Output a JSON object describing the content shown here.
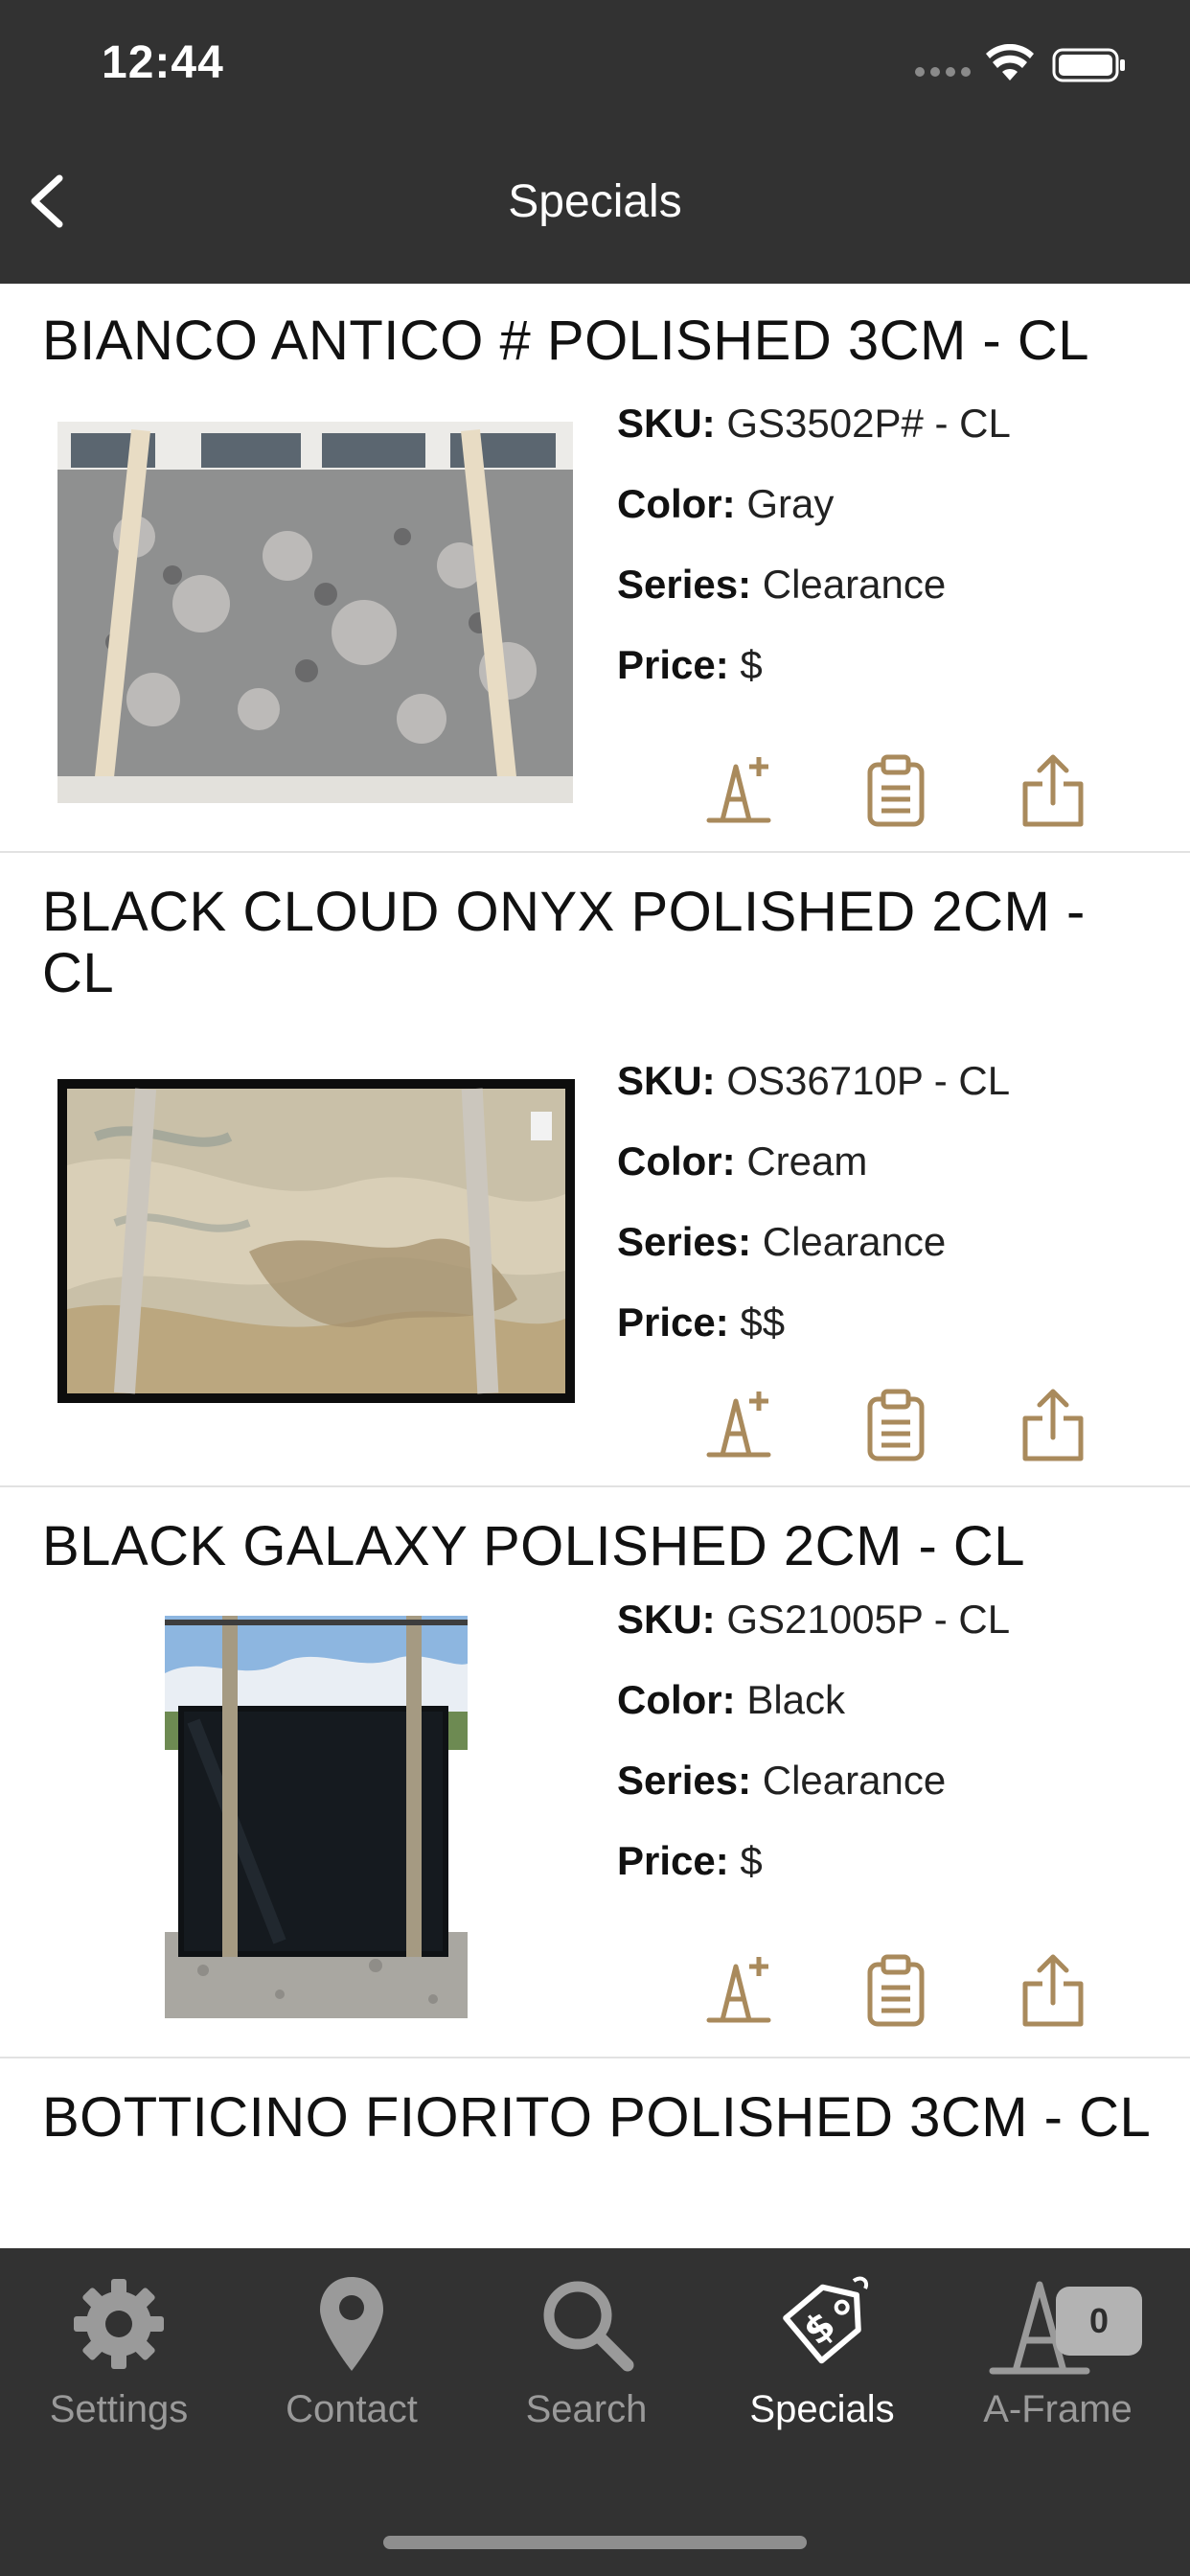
{
  "status": {
    "time": "12:44"
  },
  "nav": {
    "title": "Specials"
  },
  "labels": {
    "sku": "SKU:",
    "color": "Color:",
    "series": "Series:",
    "price": "Price:"
  },
  "items": [
    {
      "title": "BIANCO ANTICO # POLISHED 3CM - CL",
      "sku": "GS3502P# - CL",
      "color": "Gray",
      "series": "Clearance",
      "price": "$"
    },
    {
      "title": "BLACK CLOUD ONYX POLISHED 2CM - CL",
      "sku": "OS36710P - CL",
      "color": "Cream",
      "series": "Clearance",
      "price": "$$"
    },
    {
      "title": "BLACK GALAXY POLISHED 2CM - CL",
      "sku": "GS21005P - CL",
      "color": "Black",
      "series": "Clearance",
      "price": "$"
    },
    {
      "title": "BOTTICINO FIORITO POLISHED 3CM - CL",
      "sku": "",
      "color": "",
      "series": "",
      "price": ""
    }
  ],
  "tabs": [
    {
      "label": "Settings",
      "icon": "gear-icon"
    },
    {
      "label": "Contact",
      "icon": "map-pin-icon"
    },
    {
      "label": "Search",
      "icon": "search-icon"
    },
    {
      "label": "Specials",
      "icon": "price-tag-icon",
      "active": true
    },
    {
      "label": "A-Frame",
      "icon": "a-frame-icon",
      "badge": "0"
    }
  ],
  "colors": {
    "bar": "#323232",
    "accent": "#a98a5c",
    "active_tab": "#ffffff",
    "inactive_tab": "#9a9a9a"
  }
}
